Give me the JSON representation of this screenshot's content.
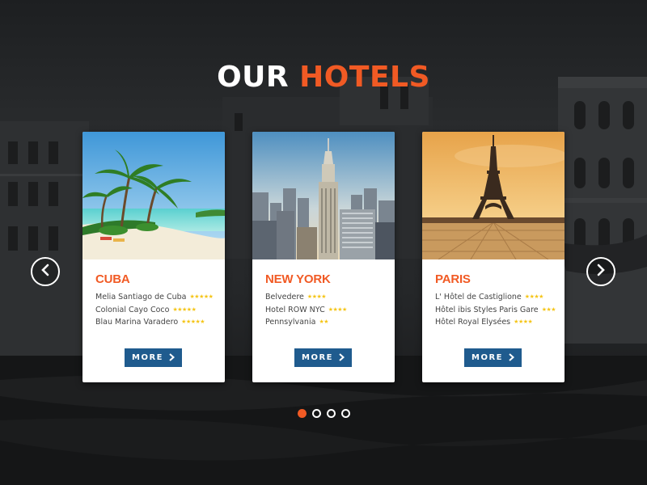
{
  "heading": {
    "word1": "OUR",
    "word2": "HOTELS"
  },
  "colors": {
    "accent": "#f15a24",
    "button": "#1f5b8e",
    "stars": "#f5c518",
    "card_bg": "#ffffff"
  },
  "cards": [
    {
      "city": "CUBA",
      "image": "tropical-beach-palms",
      "hotels": [
        {
          "name": "Melia Santiago de Cuba",
          "stars": "★★★★★"
        },
        {
          "name": "Colonial Cayo Coco",
          "stars": "★★★★★"
        },
        {
          "name": "Blau Marina Varadero",
          "stars": "★★★★★"
        }
      ],
      "button": {
        "label": "MORE",
        "icon": "chevron-right-icon"
      }
    },
    {
      "city": "NEW YORK",
      "image": "manhattan-skyline",
      "hotels": [
        {
          "name": "Belvedere",
          "stars": "★★★★"
        },
        {
          "name": "Hotel ROW NYC",
          "stars": "★★★★"
        },
        {
          "name": "Pennsylvania",
          "stars": "★★"
        }
      ],
      "button": {
        "label": "MORE",
        "icon": "chevron-right-icon"
      }
    },
    {
      "city": "PARIS",
      "image": "eiffel-tower-sunset",
      "hotels": [
        {
          "name": "L' Hôtel de Castiglione",
          "stars": "★★★★"
        },
        {
          "name": "Hôtel ibis Styles Paris Gare",
          "stars": "★★★"
        },
        {
          "name": "Hôtel Royal Elysées",
          "stars": "★★★★"
        }
      ],
      "button": {
        "label": "MORE",
        "icon": "chevron-right-icon"
      }
    }
  ],
  "carousel": {
    "prev_icon": "chevron-left-icon",
    "next_icon": "chevron-right-icon",
    "page_count": 4,
    "active_page": 1
  }
}
